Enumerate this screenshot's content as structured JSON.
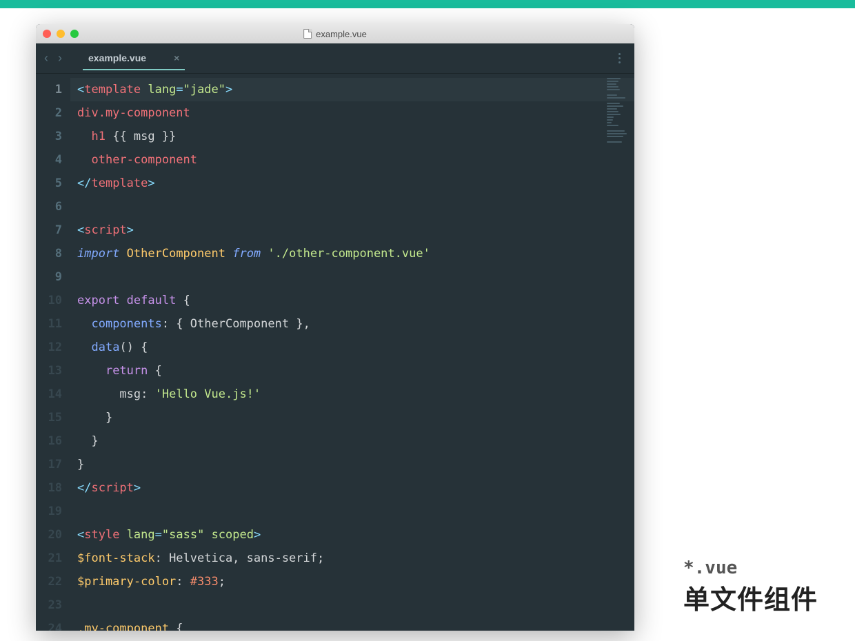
{
  "window": {
    "title": "example.vue"
  },
  "tabs": {
    "active": {
      "label": "example.vue"
    }
  },
  "caption": {
    "line1": "*.vue",
    "line2": "单文件组件"
  },
  "code": {
    "lines": [
      {
        "n": 1,
        "active": true,
        "tokens": [
          {
            "t": "<",
            "c": "c-ang"
          },
          {
            "t": "template",
            "c": "c-tag"
          },
          {
            "t": " ",
            "c": "c-pl"
          },
          {
            "t": "lang",
            "c": "c-attr"
          },
          {
            "t": "=",
            "c": "c-punc"
          },
          {
            "t": "\"jade\"",
            "c": "c-str"
          },
          {
            "t": ">",
            "c": "c-ang"
          }
        ]
      },
      {
        "n": 2,
        "tokens": [
          {
            "t": "div.my-component",
            "c": "c-tag"
          }
        ]
      },
      {
        "n": 3,
        "tokens": [
          {
            "t": "  ",
            "c": "c-pl"
          },
          {
            "t": "h1",
            "c": "c-tag"
          },
          {
            "t": " ",
            "c": "c-pl"
          },
          {
            "t": "{{ msg }}",
            "c": "c-txt"
          }
        ]
      },
      {
        "n": 4,
        "tokens": [
          {
            "t": "  ",
            "c": "c-pl"
          },
          {
            "t": "other-component",
            "c": "c-tag"
          }
        ]
      },
      {
        "n": 5,
        "tokens": [
          {
            "t": "</",
            "c": "c-ang"
          },
          {
            "t": "template",
            "c": "c-tag"
          },
          {
            "t": ">",
            "c": "c-ang"
          }
        ]
      },
      {
        "n": 6,
        "tokens": []
      },
      {
        "n": 7,
        "tokens": [
          {
            "t": "<",
            "c": "c-ang"
          },
          {
            "t": "script",
            "c": "c-tag"
          },
          {
            "t": ">",
            "c": "c-ang"
          }
        ]
      },
      {
        "n": 8,
        "tokens": [
          {
            "t": "import",
            "c": "c-import"
          },
          {
            "t": " ",
            "c": "c-pl"
          },
          {
            "t": "OtherComponent",
            "c": "c-name"
          },
          {
            "t": " ",
            "c": "c-pl"
          },
          {
            "t": "from",
            "c": "c-import"
          },
          {
            "t": " ",
            "c": "c-pl"
          },
          {
            "t": "'./other-component.vue'",
            "c": "c-str"
          }
        ]
      },
      {
        "n": 9,
        "tokens": []
      },
      {
        "n": 10,
        "tokens": [
          {
            "t": "export",
            "c": "c-kw"
          },
          {
            "t": " ",
            "c": "c-pl"
          },
          {
            "t": "default",
            "c": "c-kw"
          },
          {
            "t": " {",
            "c": "c-txt"
          }
        ]
      },
      {
        "n": 11,
        "tokens": [
          {
            "t": "  ",
            "c": "c-pl"
          },
          {
            "t": "components",
            "c": "c-fn"
          },
          {
            "t": ": { ",
            "c": "c-txt"
          },
          {
            "t": "OtherComponent",
            "c": "c-txt"
          },
          {
            "t": " },",
            "c": "c-txt"
          }
        ]
      },
      {
        "n": 12,
        "tokens": [
          {
            "t": "  ",
            "c": "c-pl"
          },
          {
            "t": "data",
            "c": "c-fn"
          },
          {
            "t": "() {",
            "c": "c-txt"
          }
        ]
      },
      {
        "n": 13,
        "tokens": [
          {
            "t": "    ",
            "c": "c-pl"
          },
          {
            "t": "return",
            "c": "c-kw"
          },
          {
            "t": " {",
            "c": "c-txt"
          }
        ]
      },
      {
        "n": 14,
        "tokens": [
          {
            "t": "      ",
            "c": "c-pl"
          },
          {
            "t": "msg",
            "c": "c-txt"
          },
          {
            "t": ": ",
            "c": "c-txt"
          },
          {
            "t": "'Hello Vue.js!'",
            "c": "c-str"
          }
        ]
      },
      {
        "n": 15,
        "tokens": [
          {
            "t": "    }",
            "c": "c-txt"
          }
        ]
      },
      {
        "n": 16,
        "tokens": [
          {
            "t": "  }",
            "c": "c-txt"
          }
        ]
      },
      {
        "n": 17,
        "tokens": [
          {
            "t": "}",
            "c": "c-txt"
          }
        ]
      },
      {
        "n": 18,
        "tokens": [
          {
            "t": "</",
            "c": "c-ang"
          },
          {
            "t": "script",
            "c": "c-tag"
          },
          {
            "t": ">",
            "c": "c-ang"
          }
        ]
      },
      {
        "n": 19,
        "tokens": []
      },
      {
        "n": 20,
        "tokens": [
          {
            "t": "<",
            "c": "c-ang"
          },
          {
            "t": "style",
            "c": "c-tag"
          },
          {
            "t": " ",
            "c": "c-pl"
          },
          {
            "t": "lang",
            "c": "c-attr"
          },
          {
            "t": "=",
            "c": "c-punc"
          },
          {
            "t": "\"sass\"",
            "c": "c-str"
          },
          {
            "t": " ",
            "c": "c-pl"
          },
          {
            "t": "scoped",
            "c": "c-attr"
          },
          {
            "t": ">",
            "c": "c-ang"
          }
        ]
      },
      {
        "n": 21,
        "tokens": [
          {
            "t": "$font-stack",
            "c": "c-sass"
          },
          {
            "t": ": Helvetica, sans-serif;",
            "c": "c-txt"
          }
        ]
      },
      {
        "n": 22,
        "tokens": [
          {
            "t": "$primary-color",
            "c": "c-sass"
          },
          {
            "t": ": ",
            "c": "c-txt"
          },
          {
            "t": "#333",
            "c": "c-var"
          },
          {
            "t": ";",
            "c": "c-txt"
          }
        ]
      },
      {
        "n": 23,
        "tokens": []
      },
      {
        "n": 24,
        "tokens": [
          {
            "t": ".my-component",
            "c": "c-sass"
          },
          {
            "t": " {",
            "c": "c-txt"
          }
        ]
      }
    ]
  },
  "minimap_widths": [
    60,
    50,
    40,
    50,
    55,
    0,
    45,
    80,
    0,
    55,
    70,
    45,
    50,
    60,
    30,
    25,
    20,
    50,
    0,
    75,
    85,
    70,
    0,
    65
  ]
}
